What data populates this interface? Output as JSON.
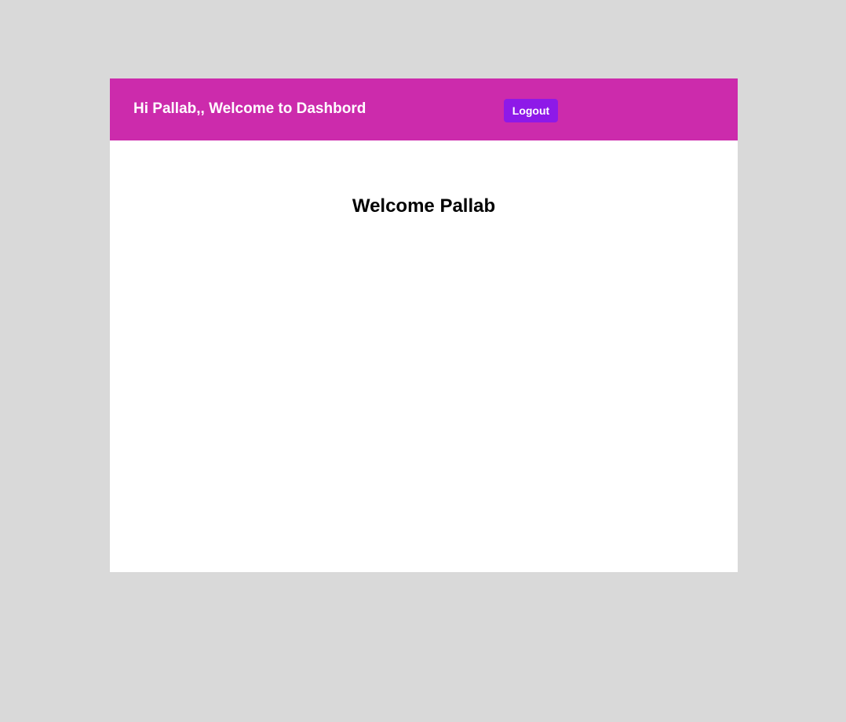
{
  "header": {
    "greeting": "Hi Pallab,, Welcome to Dashbord",
    "logout_label": "Logout"
  },
  "main": {
    "title": "Welcome Pallab"
  },
  "colors": {
    "page_background": "#d9d9d9",
    "header_background": "#cc2bac",
    "logout_button": "#8e19e8",
    "card_background": "#ffffff"
  }
}
